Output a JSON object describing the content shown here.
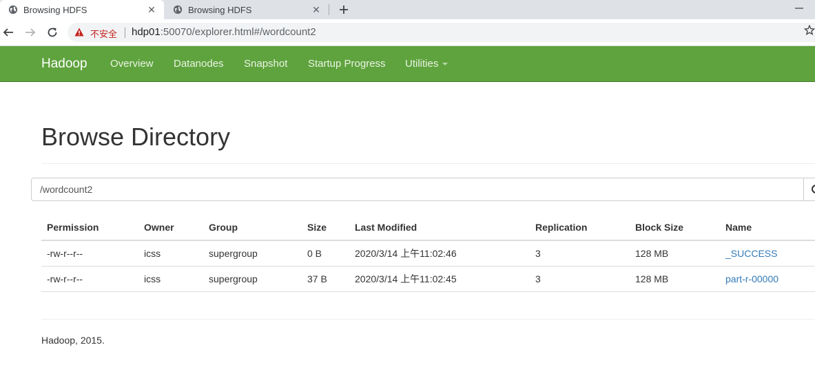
{
  "browser": {
    "tabs": [
      {
        "title": "Browsing HDFS",
        "active": true
      },
      {
        "title": "Browsing HDFS",
        "active": false
      }
    ],
    "address_bar": {
      "security_label": "不安全",
      "url_host": "hdp01",
      "url_rest": ":50070/explorer.html#/wordcount2"
    }
  },
  "navbar": {
    "brand": "Hadoop",
    "links": [
      "Overview",
      "Datanodes",
      "Snapshot",
      "Startup Progress",
      "Utilities"
    ],
    "background_color": "#5fa33e"
  },
  "main": {
    "title": "Browse Directory",
    "directory_path": "/wordcount2",
    "table": {
      "columns": [
        "Permission",
        "Owner",
        "Group",
        "Size",
        "Last Modified",
        "Replication",
        "Block Size",
        "Name"
      ],
      "rows": [
        [
          "-rw-r--r--",
          "icss",
          "supergroup",
          "0 B",
          "2020/3/14 上午11:02:46",
          "3",
          "128 MB",
          "_SUCCESS"
        ],
        [
          "-rw-r--r--",
          "icss",
          "supergroup",
          "37 B",
          "2020/3/14 上午11:02:45",
          "3",
          "128 MB",
          "part-r-00000"
        ]
      ]
    }
  },
  "footer": {
    "text": "Hadoop, 2015."
  },
  "colors": {
    "link": "#337ab7",
    "navbar": "#5fa33e",
    "insecure": "#c5221f"
  }
}
